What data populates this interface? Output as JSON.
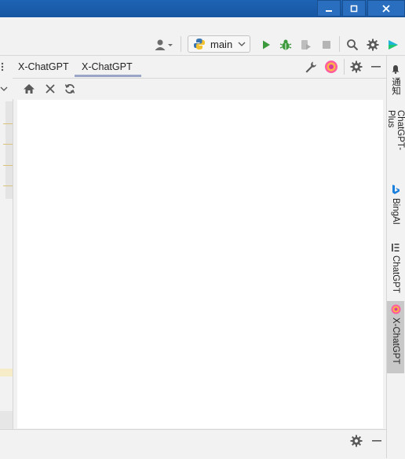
{
  "toolbar": {
    "branch_label": "main"
  },
  "tool_window": {
    "tabs": [
      {
        "label": "X-ChatGPT",
        "selected": false
      },
      {
        "label": "X-ChatGPT",
        "selected": true
      }
    ]
  },
  "right_strip": {
    "tabs": [
      {
        "label": "通知",
        "icon": "bell-icon",
        "selected": false
      },
      {
        "label": "ChatGPT-Plus",
        "icon": "",
        "selected": false
      },
      {
        "label": "BingAI",
        "icon": "bing-icon",
        "selected": false
      },
      {
        "label": "ChatGPT",
        "icon": "chatgpt-list-icon",
        "selected": false
      },
      {
        "label": "X-ChatGPT",
        "icon": "x-chatgpt-icon",
        "selected": true
      }
    ]
  },
  "colors": {
    "titlebar": "#1656a2",
    "run_green": "#3c9a3c",
    "tab_underline": "#9aa6c8",
    "selected_strip_tab": "#c8c8c8"
  }
}
